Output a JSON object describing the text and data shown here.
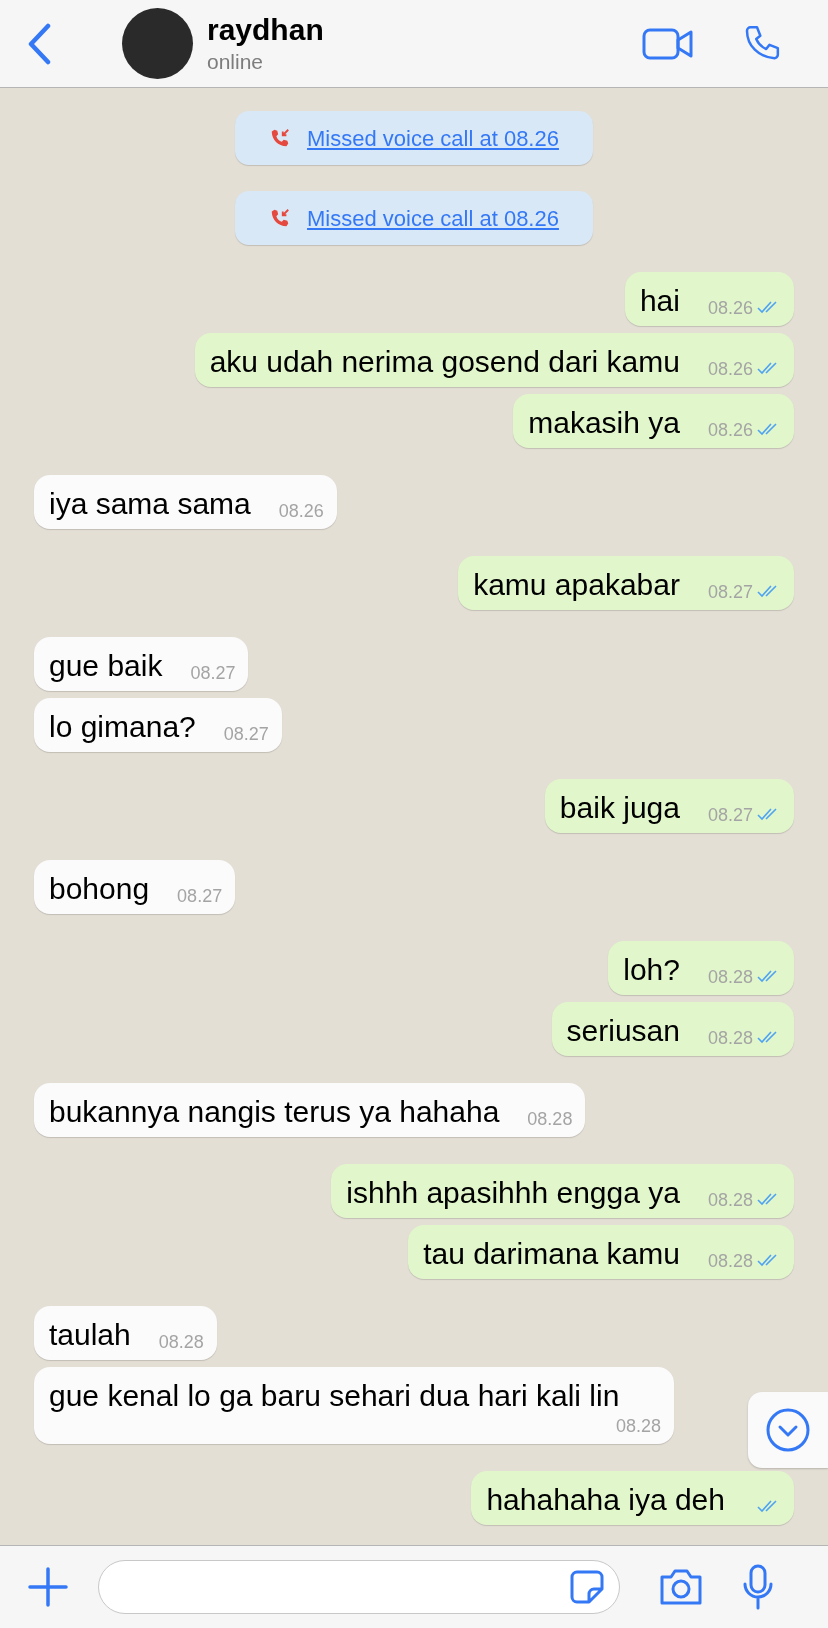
{
  "header": {
    "name": "raydhan",
    "status": "online"
  },
  "messages": [
    {
      "kind": "missed_call",
      "text": "Missed voice call at 08.26"
    },
    {
      "kind": "missed_call",
      "text": "Missed voice call at 08.26"
    },
    {
      "kind": "message",
      "outgoing": true,
      "text": "hai",
      "time": "08.26",
      "read": true
    },
    {
      "kind": "message",
      "outgoing": true,
      "text": "aku udah nerima gosend dari kamu",
      "time": "08.26",
      "read": true
    },
    {
      "kind": "message",
      "outgoing": true,
      "text": "makasih ya",
      "time": "08.26",
      "read": true
    },
    {
      "kind": "message",
      "outgoing": false,
      "text": "iya sama sama",
      "time": "08.26"
    },
    {
      "kind": "message",
      "outgoing": true,
      "text": "kamu apakabar",
      "time": "08.27",
      "read": true
    },
    {
      "kind": "message",
      "outgoing": false,
      "text": "gue baik",
      "time": "08.27"
    },
    {
      "kind": "message",
      "outgoing": false,
      "text": "lo gimana?",
      "time": "08.27"
    },
    {
      "kind": "message",
      "outgoing": true,
      "text": "baik juga",
      "time": "08.27",
      "read": true
    },
    {
      "kind": "message",
      "outgoing": false,
      "text": "bohong",
      "time": "08.27"
    },
    {
      "kind": "message",
      "outgoing": true,
      "text": "loh?",
      "time": "08.28",
      "read": true
    },
    {
      "kind": "message",
      "outgoing": true,
      "text": "seriusan",
      "time": "08.28",
      "read": true
    },
    {
      "kind": "message",
      "outgoing": false,
      "text": "bukannya nangis terus ya hahaha",
      "time": "08.28"
    },
    {
      "kind": "message",
      "outgoing": true,
      "text": "ishhh apasihhh engga ya",
      "time": "08.28",
      "read": true
    },
    {
      "kind": "message",
      "outgoing": true,
      "text": "tau darimana kamu",
      "time": "08.28",
      "read": true
    },
    {
      "kind": "message",
      "outgoing": false,
      "text": "taulah",
      "time": "08.28"
    },
    {
      "kind": "message",
      "outgoing": false,
      "text": "gue kenal lo ga baru sehari dua hari kali lin",
      "time": "08.28"
    },
    {
      "kind": "message",
      "outgoing": true,
      "text": "hahahaha iya deh",
      "read": true
    }
  ]
}
